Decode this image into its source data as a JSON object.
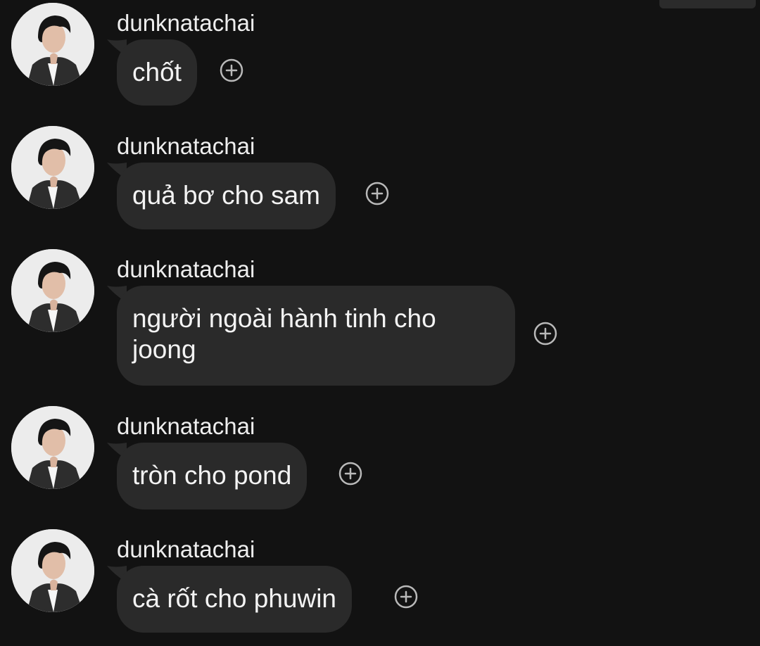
{
  "chat": {
    "messages": [
      {
        "username": "dunknatachai",
        "text": "chốt"
      },
      {
        "username": "dunknatachai",
        "text": "quả bơ cho sam"
      },
      {
        "username": "dunknatachai",
        "text": "người ngoài hành tinh cho joong"
      },
      {
        "username": "dunknatachai",
        "text": "tròn cho pond"
      },
      {
        "username": "dunknatachai",
        "text": "cà rốt cho phuwin"
      }
    ],
    "reaction_icon": "add-reaction-icon"
  },
  "colors": {
    "background": "#121212",
    "bubble": "#2a2a2a",
    "text": "#f3f3f3",
    "icon": "#b9b9b9"
  }
}
